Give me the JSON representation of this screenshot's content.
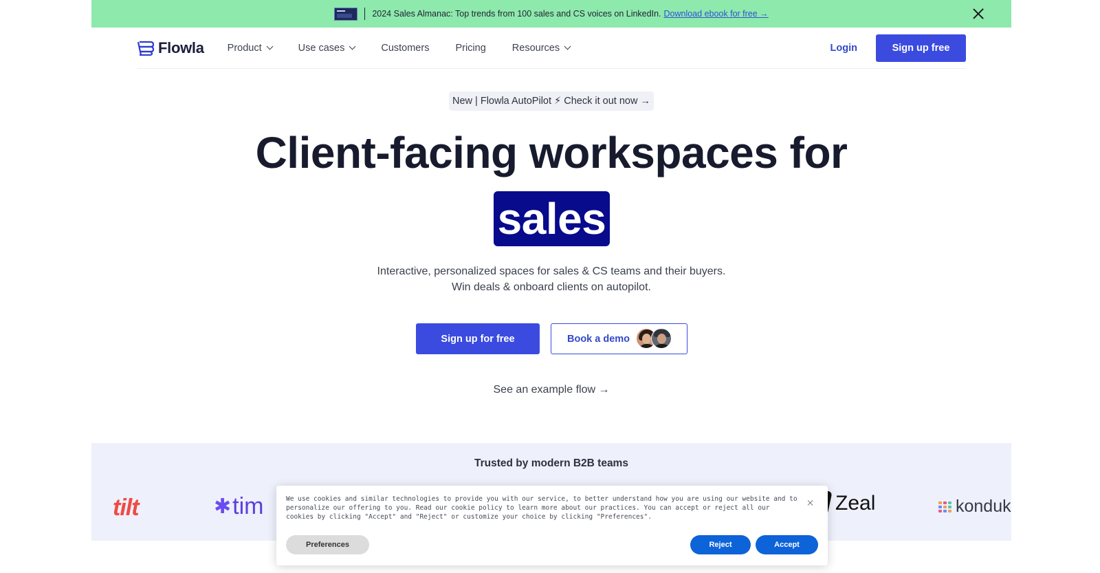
{
  "announcement": {
    "text": "2024 Sales Almanac: Top trends from 100 sales and CS voices on LinkedIn.",
    "link": "Download ebook for free →",
    "bg_color": "#8ee9ac",
    "icon": "close-icon"
  },
  "nav": {
    "logo": "Flowla",
    "items": [
      {
        "label": "Product",
        "has_dropdown": true
      },
      {
        "label": "Use cases",
        "has_dropdown": true
      },
      {
        "label": "Customers",
        "has_dropdown": false
      },
      {
        "label": "Pricing",
        "has_dropdown": false
      },
      {
        "label": "Resources",
        "has_dropdown": true
      }
    ],
    "login": "Login",
    "signup": "Sign up free"
  },
  "hero": {
    "pill": "New | Flowla AutoPilot ⚡ Check it out now →",
    "title": "Client-facing workspaces for",
    "highlight": "sales",
    "subtitle_line1": "Interactive, personalized spaces for sales & CS teams and their buyers.",
    "subtitle_line2": "Win deals & onboard clients on autopilot.",
    "cta_primary": "Sign up for free",
    "cta_demo": "Book a demo",
    "example_link": "See an example flow →"
  },
  "trusted": {
    "title": "Trusted by modern B2B teams",
    "logos": [
      "tilt",
      "tim",
      "Zeal",
      "konduk"
    ]
  },
  "cookie": {
    "text": "We use cookies and similar technologies to provide you with our service, to better understand how you are using our website and to personalize our offering to you. Read our cookie policy to learn more about our practices. You can accept or reject all our cookies by clicking \"Accept\" and \"Reject\" or customize your choice by clicking \"Preferences\".",
    "preferences": "Preferences",
    "reject": "Reject",
    "accept": "Accept"
  },
  "colors": {
    "brand": "#3b4be0",
    "highlight_bg": "#080b8c",
    "cookie_button": "#0d63d8"
  }
}
